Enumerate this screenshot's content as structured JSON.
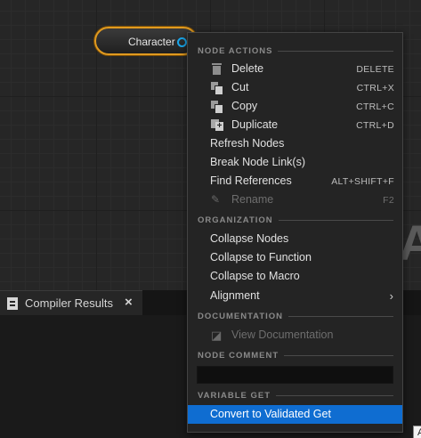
{
  "graph": {
    "node_label": "Character",
    "background_letter": "A"
  },
  "compiler_panel": {
    "tab_label": "Compiler Results",
    "close_glyph": "×"
  },
  "corner_snippet": "A",
  "menu": {
    "sections": {
      "node_actions": "NODE ACTIONS",
      "organization": "ORGANIZATION",
      "documentation": "DOCUMENTATION",
      "node_comment": "NODE COMMENT",
      "variable_get": "VARIABLE GET"
    },
    "items": {
      "delete": {
        "label": "Delete",
        "shortcut": "DELETE",
        "icon": "trash-icon"
      },
      "cut": {
        "label": "Cut",
        "shortcut": "CTRL+X",
        "icon": "cut-icon"
      },
      "copy": {
        "label": "Copy",
        "shortcut": "CTRL+C",
        "icon": "copy-icon"
      },
      "duplicate": {
        "label": "Duplicate",
        "shortcut": "CTRL+D",
        "icon": "duplicate-icon"
      },
      "refresh_nodes": {
        "label": "Refresh Nodes"
      },
      "break_links": {
        "label": "Break Node Link(s)"
      },
      "find_references": {
        "label": "Find References",
        "shortcut": "ALT+SHIFT+F"
      },
      "rename": {
        "label": "Rename",
        "shortcut": "F2",
        "icon": "rename-icon",
        "enabled": false
      },
      "collapse_nodes": {
        "label": "Collapse Nodes"
      },
      "collapse_function": {
        "label": "Collapse to Function"
      },
      "collapse_macro": {
        "label": "Collapse to Macro"
      },
      "alignment": {
        "label": "Alignment",
        "arrow": "›"
      },
      "view_documentation": {
        "label": "View Documentation",
        "icon": "documentation-icon",
        "enabled": false
      },
      "convert_validated_get": {
        "label": "Convert to Validated Get",
        "highlighted": true
      }
    },
    "node_comment_value": ""
  },
  "colors": {
    "accent": "#0f6dd1",
    "node_border": "#e09a20",
    "pin": "#1aa7ec",
    "menu_bg": "#242424"
  }
}
